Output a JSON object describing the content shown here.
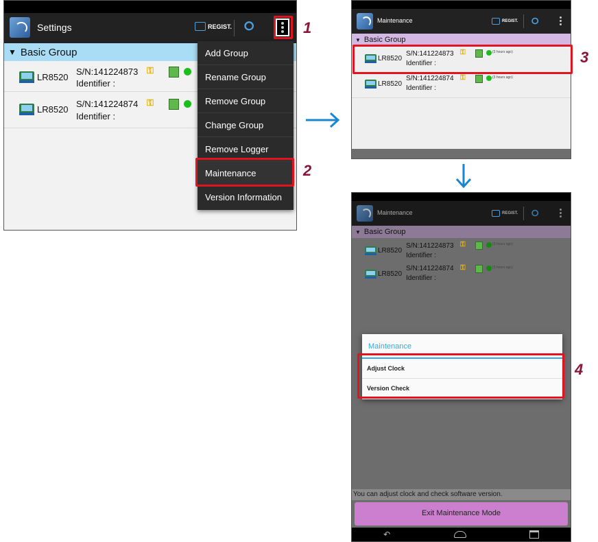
{
  "settings_screen": {
    "title": "Settings",
    "regist_label": "REGIST.",
    "group_name": "Basic Group",
    "loggers": [
      {
        "model": "LR8520",
        "serial": "S/N:141224873",
        "identifier": "Identifier :"
      },
      {
        "model": "LR8520",
        "serial": "S/N:141224874",
        "identifier": "Identifier :"
      }
    ],
    "menu_items": [
      "Add Group",
      "Rename Group",
      "Remove Group",
      "Change Group",
      "Remove Logger",
      "Maintenance",
      "Version Information"
    ],
    "selected_menu_item": "Maintenance"
  },
  "maintenance_screen": {
    "title": "Maintenance",
    "regist_label": "REGIST.",
    "group_name": "Basic Group",
    "loggers": [
      {
        "model": "LR8520",
        "serial": "S/N:141224873",
        "identifier": "Identifier :",
        "last_seen": "(3 hours ago)"
      },
      {
        "model": "LR8520",
        "serial": "S/N:141224874",
        "identifier": "Identifier :",
        "last_seen": "(3 hours ago)"
      }
    ]
  },
  "maintenance_dialog_screen": {
    "title": "Maintenance",
    "regist_label": "REGIST.",
    "group_name": "Basic Group",
    "loggers": [
      {
        "model": "LR8520",
        "serial": "S/N:141224873",
        "identifier": "Identifier :",
        "last_seen": "(3 hours ago)"
      },
      {
        "model": "LR8520",
        "serial": "S/N:141224874",
        "identifier": "Identifier :",
        "last_seen": "(3 hours ago)"
      }
    ],
    "dialog": {
      "title": "Maintenance",
      "options": [
        "Adjust Clock",
        "Version Check"
      ]
    },
    "hint": "You can adjust clock and check software version.",
    "exit_button": "Exit Maintenance Mode"
  },
  "steps": [
    "1",
    "2",
    "3",
    "4"
  ],
  "colors": {
    "action_bar": "#222222",
    "group_header_blue": "#a9dcf5",
    "group_header_purple": "#d4b8e4",
    "highlight_red": "#e0141e",
    "step_number": "#8a1538",
    "arrow_blue": "#1a86d0",
    "exit_button": "#cc7fcf",
    "dialog_title": "#33aadd"
  },
  "icons": [
    "app-icon",
    "regist-icon",
    "wireless-icon",
    "overflow-menu-icon",
    "logger-icon",
    "key-icon",
    "signal-icon",
    "status-dot-icon",
    "back-icon",
    "home-icon",
    "recents-icon",
    "arrow-right-icon",
    "arrow-down-icon"
  ]
}
